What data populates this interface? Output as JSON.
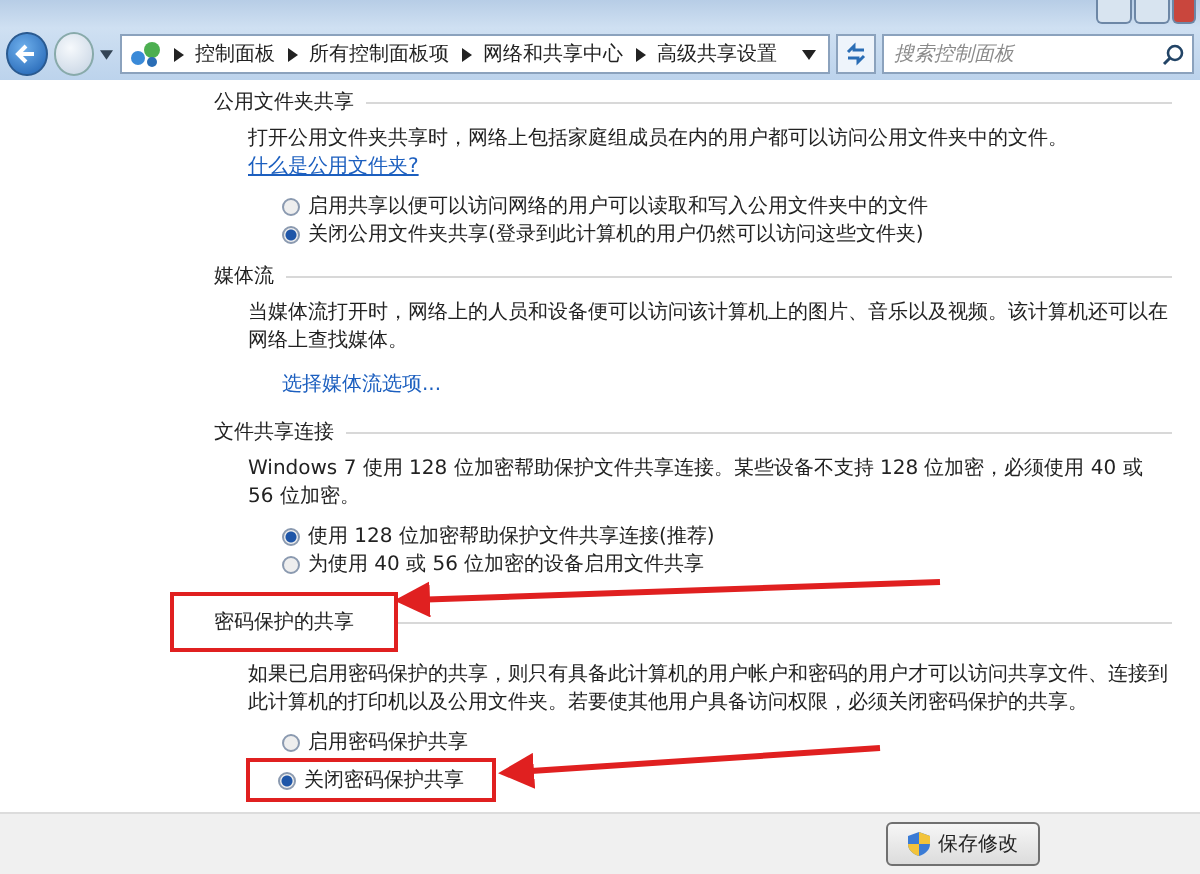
{
  "address_bar": {
    "breadcrumbs": [
      "控制面板",
      "所有控制面板项",
      "网络和共享中心",
      "高级共享设置"
    ],
    "search": {
      "placeholder": "搜索控制面板"
    }
  },
  "sections": [
    {
      "title": "公用文件夹共享",
      "highlighted": false,
      "paragraph": "打开公用文件夹共享时，网络上包括家庭组成员在内的用户都可以访问公用文件夹中的文件。",
      "link": "什么是公用文件夹?",
      "options": [
        {
          "label": "启用共享以便可以访问网络的用户可以读取和写入公用文件夹中的文件",
          "selected": false,
          "highlighted": false
        },
        {
          "label": "关闭公用文件夹共享(登录到此计算机的用户仍然可以访问这些文件夹)",
          "selected": true,
          "highlighted": false
        }
      ]
    },
    {
      "title": "媒体流",
      "highlighted": false,
      "paragraph": "当媒体流打开时，网络上的人员和设备便可以访问该计算机上的图片、音乐以及视频。该计算机还可以在网络上查找媒体。",
      "action_link": "选择媒体流选项..."
    },
    {
      "title": "文件共享连接",
      "highlighted": false,
      "paragraph": "Windows 7 使用 128 位加密帮助保护文件共享连接。某些设备不支持 128 位加密，必须使用 40 或 56 位加密。",
      "options": [
        {
          "label": "使用 128 位加密帮助保护文件共享连接(推荐)",
          "selected": true,
          "highlighted": false
        },
        {
          "label": "为使用 40 或 56 位加密的设备启用文件共享",
          "selected": false,
          "highlighted": false
        }
      ]
    },
    {
      "title": "密码保护的共享",
      "highlighted": true,
      "paragraph": "如果已启用密码保护的共享，则只有具备此计算机的用户帐户和密码的用户才可以访问共享文件、连接到此计算机的打印机以及公用文件夹。若要使其他用户具备访问权限，必须关闭密码保护的共享。",
      "options": [
        {
          "label": "启用密码保护共享",
          "selected": false,
          "highlighted": false
        },
        {
          "label": "关闭密码保护共享",
          "selected": true,
          "highlighted": true
        }
      ]
    }
  ],
  "buttons": [
    {
      "label": "保存修改"
    }
  ]
}
